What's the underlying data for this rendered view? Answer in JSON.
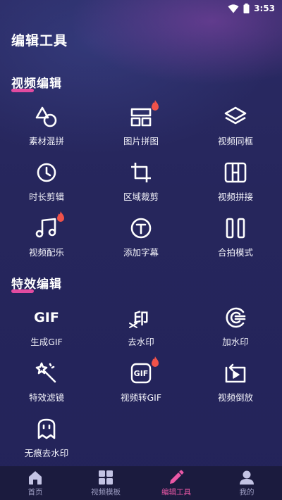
{
  "status_bar": {
    "time": "3:53"
  },
  "page_title": "编辑工具",
  "sections": [
    {
      "title": "视频编辑",
      "tools": [
        {
          "label": "素材混拼",
          "icon": "shapes-mix-icon",
          "hot": false
        },
        {
          "label": "图片拼图",
          "icon": "collage-grid-icon",
          "hot": true
        },
        {
          "label": "视频同框",
          "icon": "layers-icon",
          "hot": false
        },
        {
          "label": "时长剪辑",
          "icon": "clock-icon",
          "hot": false
        },
        {
          "label": "区域裁剪",
          "icon": "crop-icon",
          "hot": false
        },
        {
          "label": "视频拼接",
          "icon": "join-frames-icon",
          "hot": false
        },
        {
          "label": "视频配乐",
          "icon": "music-note-icon",
          "hot": true
        },
        {
          "label": "添加字幕",
          "icon": "text-t-icon",
          "hot": false
        },
        {
          "label": "合拍模式",
          "icon": "split-bars-icon",
          "hot": false
        }
      ]
    },
    {
      "title": "特效编辑",
      "tools": [
        {
          "label": "生成GIF",
          "icon": "gif-text-icon",
          "hot": false,
          "glyph": "GIF"
        },
        {
          "label": "去水印",
          "icon": "remove-watermark-icon",
          "hot": false,
          "glyph": "印"
        },
        {
          "label": "加水印",
          "icon": "add-watermark-icon",
          "hot": false
        },
        {
          "label": "特效滤镜",
          "icon": "magic-wand-icon",
          "hot": false
        },
        {
          "label": "视频转GIF",
          "icon": "gif-badge-icon",
          "hot": true,
          "glyph": "GIF"
        },
        {
          "label": "视频倒放",
          "icon": "reverse-play-icon",
          "hot": false
        },
        {
          "label": "无痕去水印",
          "icon": "ghost-icon",
          "hot": false
        }
      ]
    }
  ],
  "bottom_nav": [
    {
      "label": "首页",
      "icon": "home-icon",
      "active": false
    },
    {
      "label": "视频模板",
      "icon": "template-grid-icon",
      "active": false
    },
    {
      "label": "编辑工具",
      "icon": "pencil-icon",
      "active": true
    },
    {
      "label": "我的",
      "icon": "user-icon",
      "active": false
    }
  ],
  "colors": {
    "background": "#232356",
    "accent": "#e24ba0",
    "hot_badge": "#f0524a",
    "nav_active": "#ea58a6",
    "nav_inactive": "#9d9dc2"
  }
}
